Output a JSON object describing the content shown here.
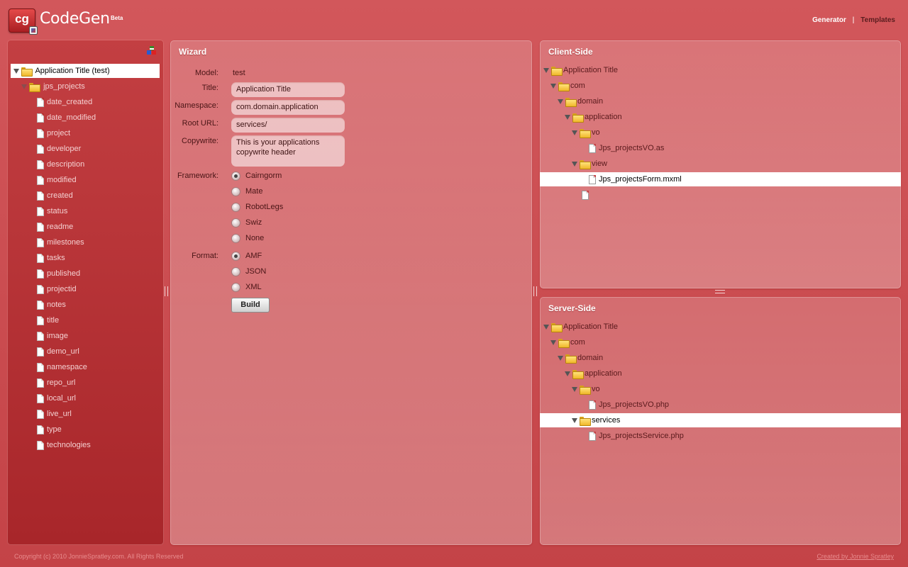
{
  "header": {
    "logo_text": "cg",
    "app_name": "CodeGen",
    "beta_label": "Beta",
    "nav": {
      "generator": "Generator",
      "separator": "|",
      "templates": "Templates"
    }
  },
  "left_tree": {
    "root_label": "Application Title (test)",
    "folder_label": "jps_projects",
    "fields": [
      "date_created",
      "date_modified",
      "project",
      "developer",
      "description",
      "modified",
      "created",
      "status",
      "readme",
      "milestones",
      "tasks",
      "published",
      "projectid",
      "notes",
      "title",
      "image",
      "demo_url",
      "namespace",
      "repo_url",
      "local_url",
      "live_url",
      "type",
      "technologies"
    ]
  },
  "wizard": {
    "title": "Wizard",
    "model_label": "Model:",
    "model_value": "test",
    "title_label": "Title:",
    "title_value": "Application Title",
    "namespace_label": "Namespace:",
    "namespace_value": "com.domain.application",
    "root_url_label": "Root URL:",
    "root_url_value": "services/",
    "copywrite_label": "Copywrite:",
    "copywrite_value": "This is your applications copywrite header",
    "framework_label": "Framework:",
    "frameworks": [
      "Cairngorm",
      "Mate",
      "RobotLegs",
      "Swiz",
      "None"
    ],
    "framework_selected": "Cairngorm",
    "format_label": "Format:",
    "formats": [
      "AMF",
      "JSON",
      "XML"
    ],
    "format_selected": "AMF",
    "build_label": "Build"
  },
  "client_side": {
    "title": "Client-Side",
    "root": "Application Title",
    "com": "com",
    "domain": "domain",
    "application": "application",
    "vo": "vo",
    "vo_file": "Jps_projectsVO.as",
    "view": "view",
    "view_file": "Jps_projectsForm.mxml"
  },
  "server_side": {
    "title": "Server-Side",
    "root": "Application Title",
    "com": "com",
    "domain": "domain",
    "application": "application",
    "vo": "vo",
    "vo_file": "Jps_projectsVO.php",
    "services": "services",
    "services_file": "Jps_projectsService.php"
  },
  "footer": {
    "copyright": "Copyright (c) 2010 JonnieSpratley.com. All Rights Reserved",
    "credit": "Created by Jonnie Spratley"
  }
}
